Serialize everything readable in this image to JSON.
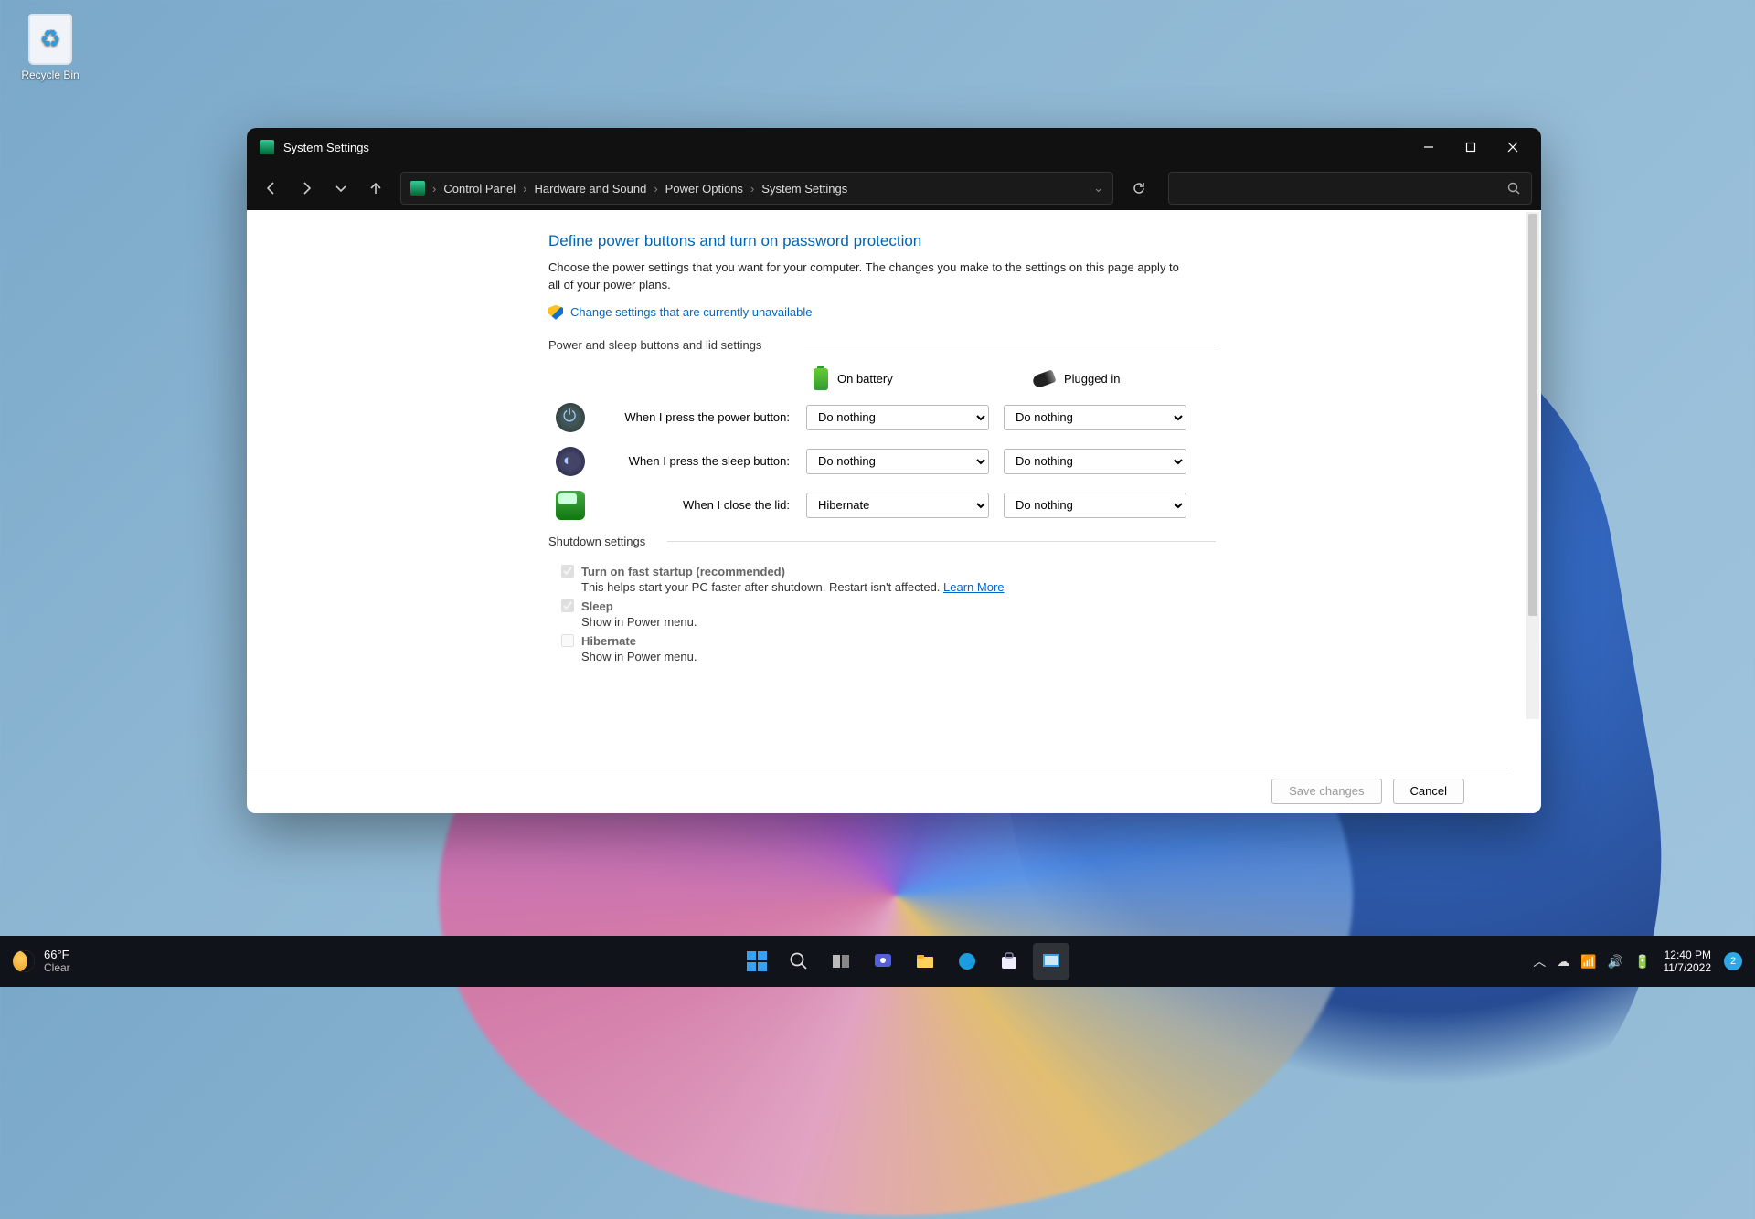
{
  "desktop": {
    "recycle_bin": "Recycle Bin"
  },
  "window": {
    "title": "System Settings",
    "breadcrumbs": [
      "Control Panel",
      "Hardware and Sound",
      "Power Options",
      "System Settings"
    ]
  },
  "page": {
    "heading": "Define power buttons and turn on password protection",
    "description": "Choose the power settings that you want for your computer. The changes you make to the settings on this page apply to all of your power plans.",
    "change_link": "Change settings that are currently unavailable",
    "section1": "Power and sleep buttons and lid settings",
    "col_battery": "On battery",
    "col_plugged": "Plugged in",
    "row_power": "When I press the power button:",
    "row_sleep": "When I press the sleep button:",
    "row_lid": "When I close the lid:",
    "val_power_batt": "Do nothing",
    "val_power_plug": "Do nothing",
    "val_sleep_batt": "Do nothing",
    "val_sleep_plug": "Do nothing",
    "val_lid_batt": "Hibernate",
    "val_lid_plug": "Do nothing",
    "section2": "Shutdown settings",
    "fast_startup": "Turn on fast startup (recommended)",
    "fast_startup_desc": "This helps start your PC faster after shutdown. Restart isn't affected. ",
    "learn_more": "Learn More",
    "sleep_opt": "Sleep",
    "sleep_desc": "Show in Power menu.",
    "hibernate_opt": "Hibernate",
    "hibernate_desc": "Show in Power menu.",
    "save": "Save changes",
    "cancel": "Cancel"
  },
  "taskbar": {
    "temp": "66°F",
    "cond": "Clear",
    "time": "12:40 PM",
    "date": "11/7/2022",
    "notif_count": "2"
  }
}
